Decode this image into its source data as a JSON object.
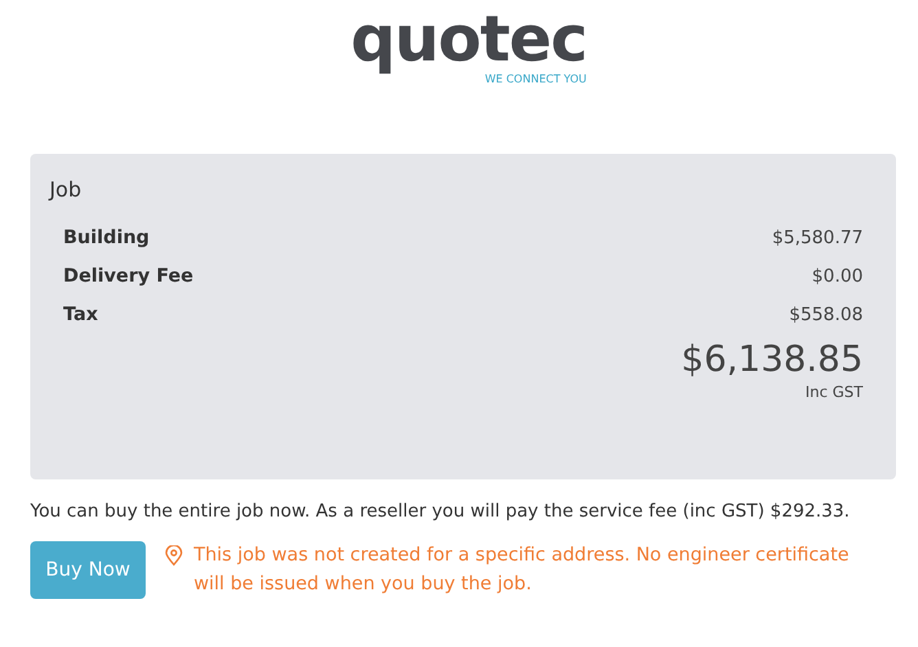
{
  "logo": {
    "name": "quotec",
    "tagline": "WE CONNECT YOU"
  },
  "summary": {
    "title": "Job",
    "lines": [
      {
        "label": "Building",
        "amount": "$5,580.77"
      },
      {
        "label": "Delivery Fee",
        "amount": "$0.00"
      },
      {
        "label": "Tax",
        "amount": "$558.08"
      }
    ],
    "total": "$6,138.85",
    "total_note": "Inc GST"
  },
  "message": "You can buy the entire job now. As a reseller you will pay the service fee (inc GST) $292.33.",
  "buy_button": "Buy Now",
  "warning": "This job was not created for a specific address. No engineer certificate will be issued when you buy the job."
}
